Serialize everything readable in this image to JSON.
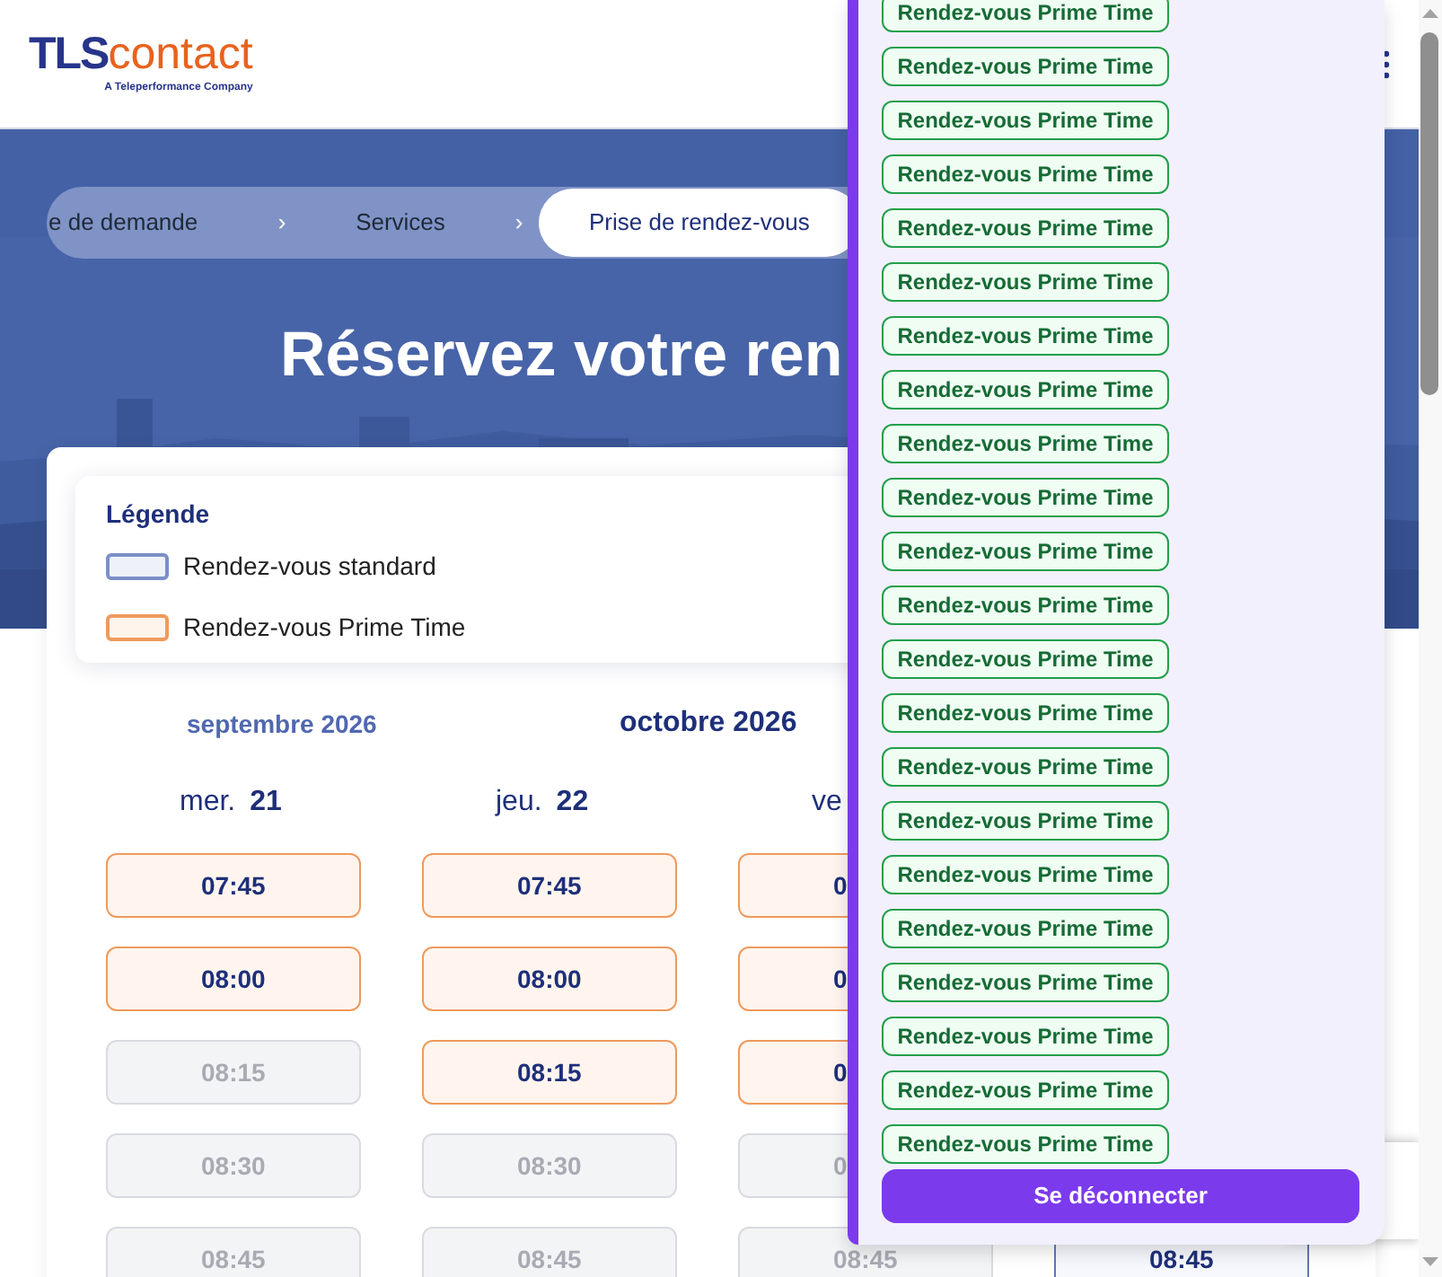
{
  "header": {
    "logo": {
      "brand_part_1": "TLS",
      "brand_part_2": "contact",
      "tagline": "A Teleperformance Company"
    }
  },
  "breadcrumb": [
    {
      "label": "e de demande",
      "selected": false
    },
    {
      "separator_before": "›",
      "label": "Services",
      "selected": false
    },
    {
      "separator_before": "›",
      "label": "Prise de rendez-vous",
      "selected": true
    }
  ],
  "hero": {
    "title": "Réservez votre ren"
  },
  "legend": {
    "title": "Légende",
    "items": [
      {
        "kind": "standard",
        "label": "Rendez-vous standard"
      },
      {
        "kind": "prime",
        "label": "Rendez-vous Prime Time"
      }
    ]
  },
  "months": [
    {
      "label": "septembre 2026",
      "selected": false
    },
    {
      "label": "octobre 2026",
      "selected": true
    }
  ],
  "days": [
    {
      "weekday": "mer.",
      "day": "21",
      "slots": [
        {
          "time": "07:45",
          "kind": "prime"
        },
        {
          "time": "08:00",
          "kind": "prime"
        },
        {
          "time": "08:15",
          "kind": "unavailable"
        },
        {
          "time": "08:30",
          "kind": "unavailable"
        },
        {
          "time": "08:45",
          "kind": "unavailable"
        }
      ]
    },
    {
      "weekday": "jeu.",
      "day": "22",
      "slots": [
        {
          "time": "07:45",
          "kind": "prime"
        },
        {
          "time": "08:00",
          "kind": "prime"
        },
        {
          "time": "08:15",
          "kind": "prime"
        },
        {
          "time": "08:30",
          "kind": "unavailable"
        },
        {
          "time": "08:45",
          "kind": "unavailable"
        }
      ]
    },
    {
      "weekday": "ve",
      "slots": [
        {
          "time": "0",
          "kind": "prime"
        },
        {
          "time": "0",
          "kind": "prime"
        },
        {
          "time": "0",
          "kind": "prime"
        },
        {
          "time": "0",
          "kind": "unavailable"
        },
        {
          "time": "08:45",
          "kind": "unavailable"
        }
      ]
    },
    {
      "slots": [
        {
          "time": "08:45",
          "kind": "standard"
        }
      ]
    }
  ],
  "overlay": {
    "items": [
      "Rendez-vous Prime Time",
      "Rendez-vous Prime Time",
      "Rendez-vous Prime Time",
      "Rendez-vous Prime Time",
      "Rendez-vous Prime Time",
      "Rendez-vous Prime Time",
      "Rendez-vous Prime Time",
      "Rendez-vous Prime Time",
      "Rendez-vous Prime Time",
      "Rendez-vous Prime Time",
      "Rendez-vous Prime Time",
      "Rendez-vous Prime Time",
      "Rendez-vous Prime Time",
      "Rendez-vous Prime Time",
      "Rendez-vous Prime Time",
      "Rendez-vous Prime Time",
      "Rendez-vous Prime Time",
      "Rendez-vous Prime Time",
      "Rendez-vous Prime Time",
      "Rendez-vous Prime Time",
      "Rendez-vous Prime Time",
      "Rendez-vous Prime Time"
    ],
    "logout": "Se déconnecter"
  }
}
